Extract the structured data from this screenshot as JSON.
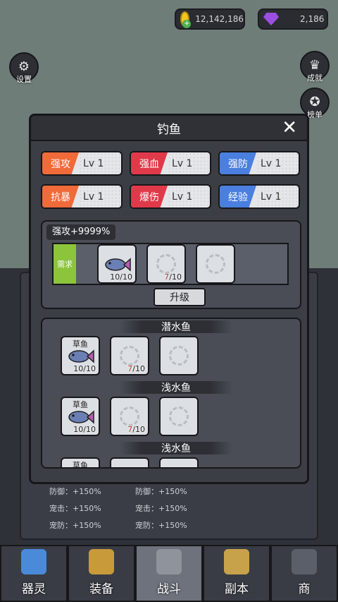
{
  "currency": {
    "gold": "12,142,186",
    "gems": "2,186"
  },
  "side_buttons": {
    "settings": "设置",
    "achievements": "成就",
    "ranking": "榜单"
  },
  "modal": {
    "title": "钓鱼",
    "close": "✕"
  },
  "attributes": [
    {
      "name": "强攻",
      "level": "Lv 1",
      "color": "#f06a3a"
    },
    {
      "name": "强血",
      "level": "Lv 1",
      "color": "#e03a4a"
    },
    {
      "name": "强防",
      "level": "Lv 1",
      "color": "#4a7fe0"
    },
    {
      "name": "抗暴",
      "level": "Lv 1",
      "color": "#f06a3a"
    },
    {
      "name": "爆伤",
      "level": "Lv 1",
      "color": "#e03a4a"
    },
    {
      "name": "经验",
      "level": "Lv 1",
      "color": "#4a7fe0"
    }
  ],
  "upgrade": {
    "bonus": "强攻+9999%",
    "requirement_label": "需求",
    "slots": [
      {
        "have": "10",
        "need": "/10",
        "fish": true
      },
      {
        "have": "7",
        "need": "/10",
        "fish": false
      },
      {
        "have": "",
        "need": "",
        "fish": false
      }
    ],
    "button": "升级"
  },
  "sections": [
    {
      "title": "潜水鱼",
      "fish_name": "草鱼",
      "count": "10/10",
      "have": "7",
      "need": "/10"
    },
    {
      "title": "浅水鱼",
      "fish_name": "草鱼",
      "count": "10/10",
      "have": "7",
      "need": "/10"
    },
    {
      "title": "浅水鱼",
      "fish_name": "草鱼",
      "count": "",
      "have": "",
      "need": ""
    }
  ],
  "stats": [
    [
      "防御：+150%",
      "防御：+150%"
    ],
    [
      "宠击：+150%",
      "宠击：+150%"
    ],
    [
      "宠防：+150%",
      "宠防：+150%"
    ]
  ],
  "bottom_nav": [
    {
      "label": "器灵",
      "active": false
    },
    {
      "label": "装备",
      "active": false
    },
    {
      "label": "战斗",
      "active": true
    },
    {
      "label": "副本",
      "active": false
    },
    {
      "label": "商",
      "active": false
    }
  ]
}
